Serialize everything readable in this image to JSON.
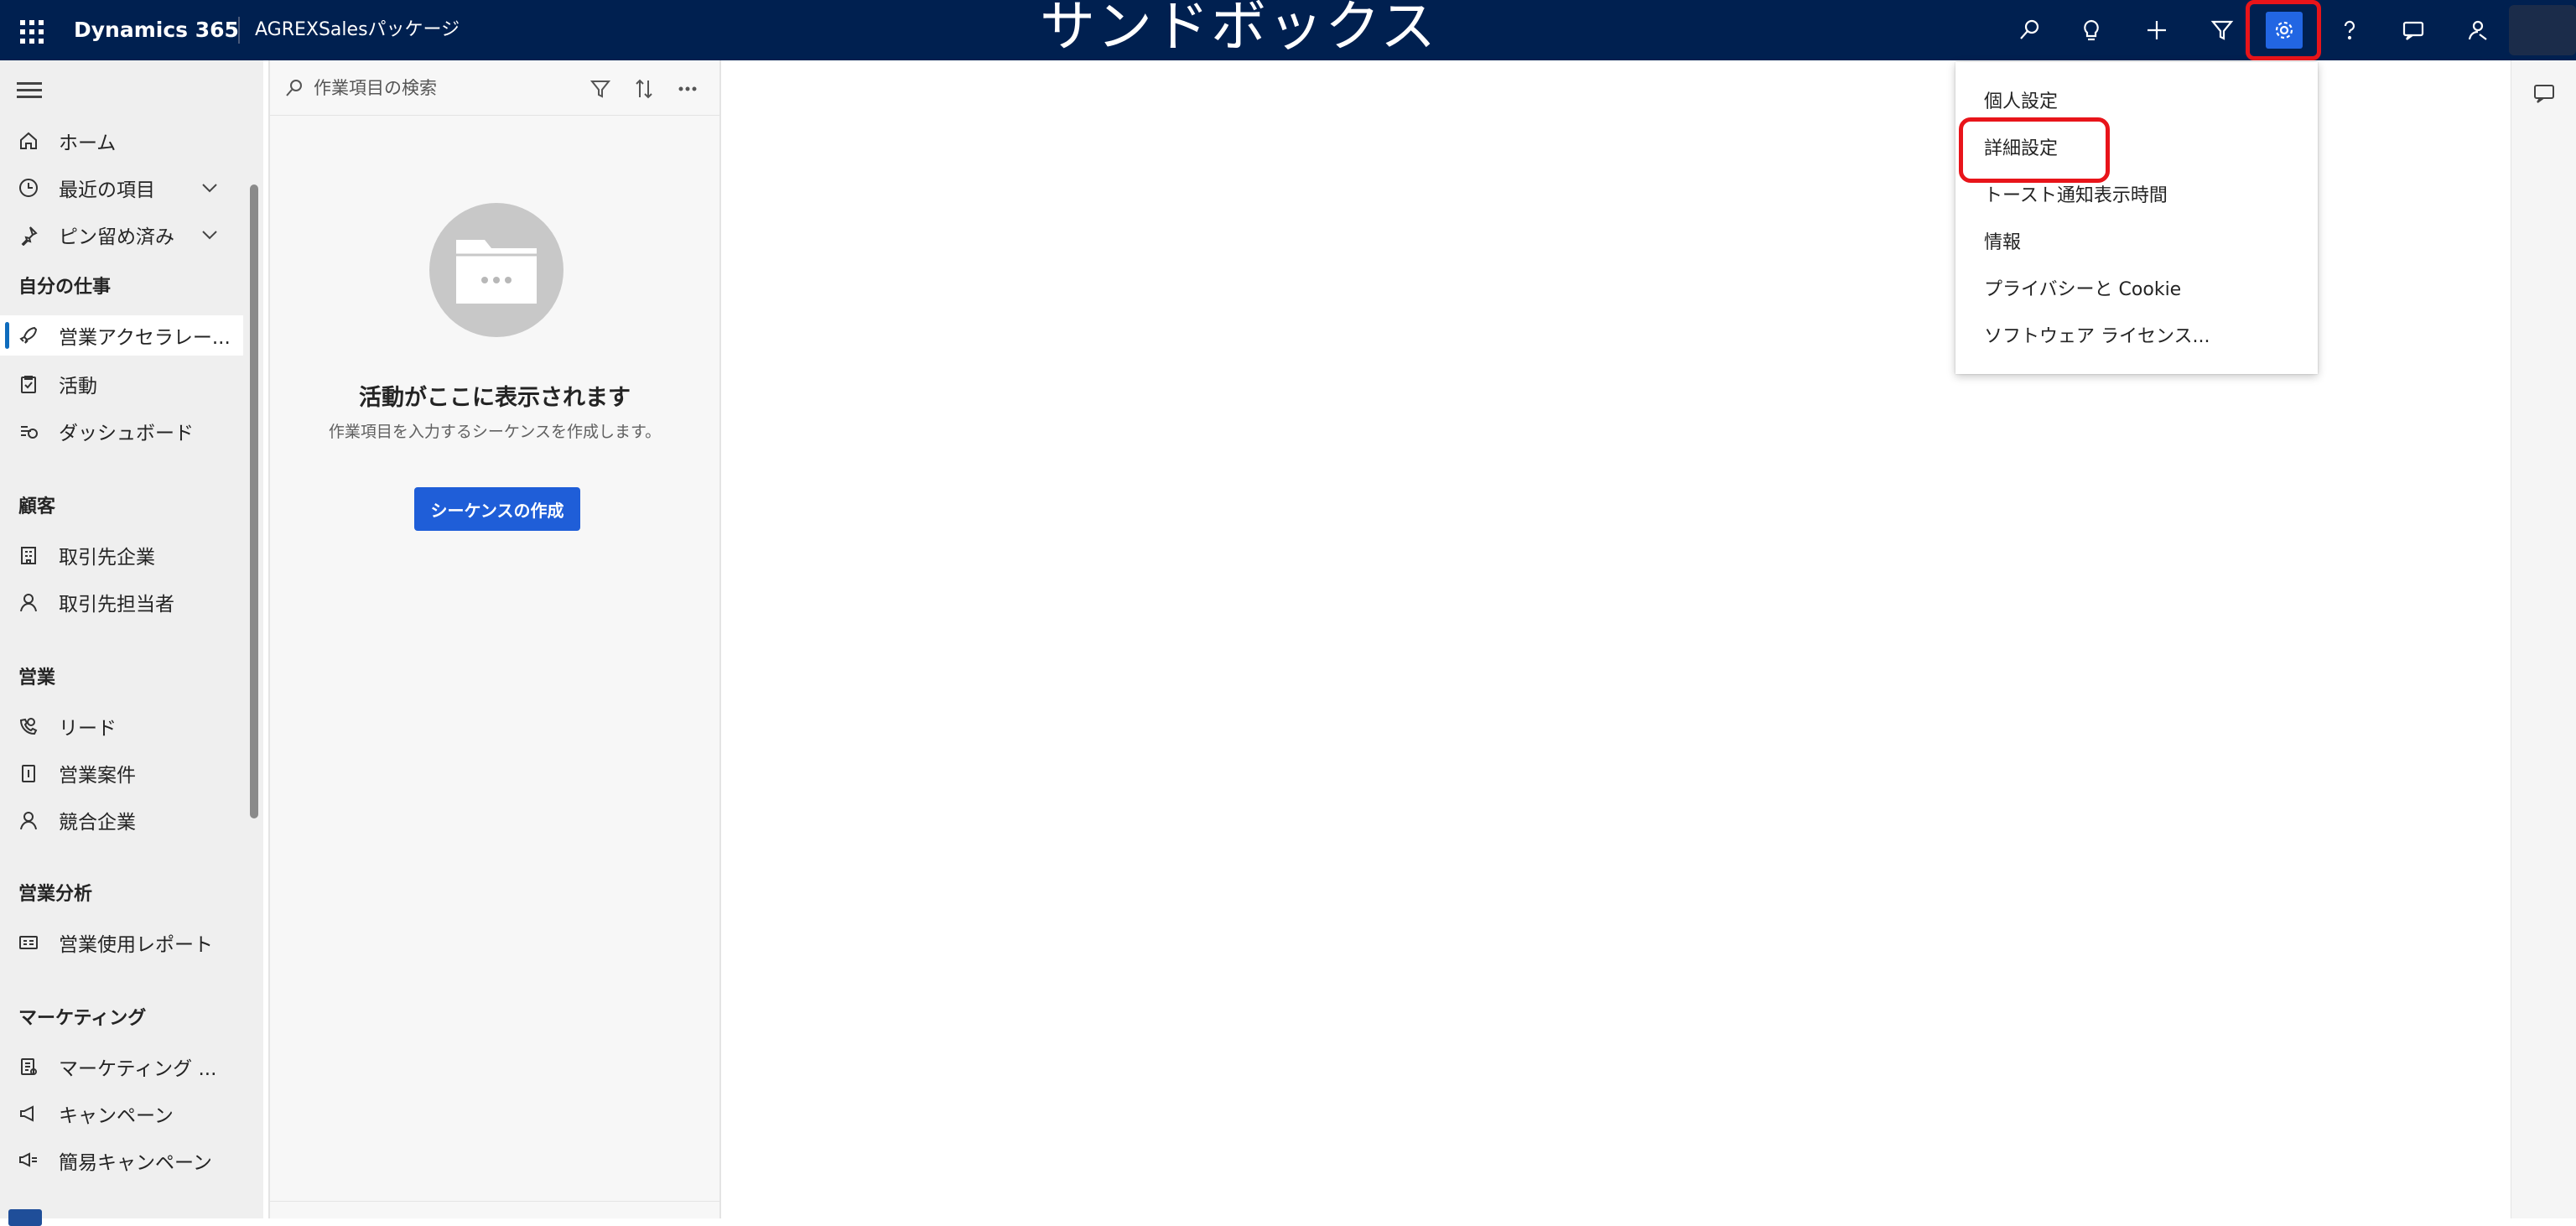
{
  "topbar": {
    "brand": "Dynamics 365",
    "app_name": "AGREXSalesパッケージ",
    "environment_banner": "サンドボックス",
    "icons": [
      "search-icon",
      "lightbulb-icon",
      "plus-icon",
      "filter-icon",
      "gear-icon",
      "help-icon",
      "chat-icon",
      "person-feedback-icon"
    ]
  },
  "nav": {
    "home": "ホーム",
    "recent": "最近の項目",
    "pinned": "ピン留め済み",
    "sections": {
      "my_work": "自分の仕事",
      "customers": "顧客",
      "sales": "営業",
      "sales_analysis": "営業分析",
      "marketing": "マーケティング"
    },
    "items": {
      "sales_accelerator": "営業アクセラレー...",
      "activities": "活動",
      "dashboards": "ダッシュボード",
      "accounts": "取引先企業",
      "contacts": "取引先担当者",
      "leads": "リード",
      "opportunities": "営業案件",
      "competitors": "競合企業",
      "sales_usage_report": "営業使用レポート",
      "marketing_lists": "マーケティング ...",
      "campaigns": "キャンペーン",
      "quick_campaigns": "簡易キャンペーン"
    }
  },
  "worklist": {
    "search_placeholder": "作業項目の検索",
    "empty_title": "活動がここに表示されます",
    "empty_subtitle": "作業項目を入力するシーケンスを作成します。",
    "create_button": "シーケンスの作成"
  },
  "settings_menu": {
    "items": [
      "個人設定",
      "詳細設定",
      "トースト通知表示時間",
      "情報",
      "プライバシーと Cookie",
      "ソフトウェア ライセンス..."
    ],
    "highlighted": "詳細設定"
  },
  "colors": {
    "topbar": "#002050",
    "accent": "#1f5ed8",
    "highlight_box": "#e8141a"
  }
}
